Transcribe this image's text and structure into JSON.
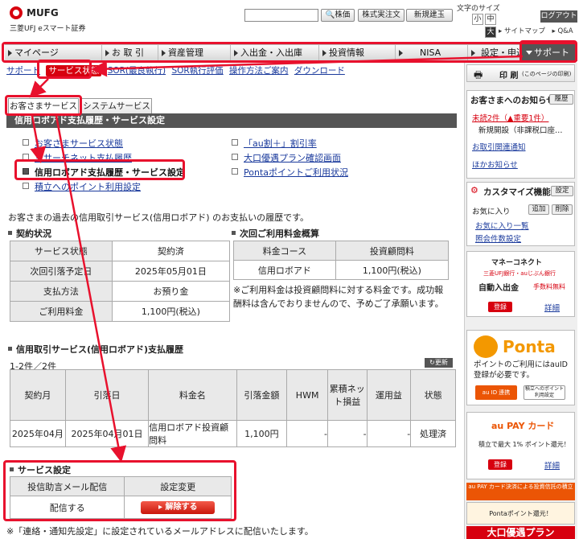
{
  "header": {
    "logo_mufg": "MUFG",
    "logo_sub": "三菱UFJ eスマート証券",
    "search_placeholder": "",
    "search_btn": "株価",
    "btn_margin": "株式実注文",
    "btn_shinki": "新規建玉",
    "fontsize_label": "文字のサイズ",
    "fs_small": "小",
    "fs_mid": "中",
    "fs_large": "大",
    "logout": "ログアウト",
    "sitemap": "▸ サイトマップ　▸ Q&A"
  },
  "nav": [
    "マイページ",
    "お 取 引",
    "資産管理",
    "入出金・入出庫",
    "投資情報",
    "NISA",
    "設定・申込"
  ],
  "nav_support": "サポート",
  "subnav": {
    "items": [
      "サポート",
      "サービス状態",
      "SOR(最良執行)",
      "SOR執行評価",
      "操作方法ご案内",
      "ダウンロード"
    ],
    "current": "サービス状態"
  },
  "tabs": {
    "customer": "お客さまサービス",
    "system": "システムサービス"
  },
  "title": "信用ロボアド支払履歴・サービス設定",
  "links_left": [
    "お客さまサービス状態",
    "リサーチネット支払履歴",
    "信用ロボアド支払履歴・サービス設定",
    "積立へのポイント利用設定"
  ],
  "links_right": [
    "「au割＋」割引率",
    "大口優遇プラン確認画面",
    "Pontaポイントご利用状況"
  ],
  "intro": "お客さまの過去の信用取引サービス(信用ロボアド) のお支払いの履歴です。",
  "contract": {
    "title": "契約状況",
    "rows": [
      {
        "label": "サービス状態",
        "value": "契約済"
      },
      {
        "label": "次回引落予定日",
        "value": "2025年05月01日"
      },
      {
        "label": "支払方法",
        "value": "お預り金"
      },
      {
        "label": "ご利用料金",
        "value": "1,100円(税込)"
      }
    ]
  },
  "next_fee": {
    "title": "次回ご利用料金概算",
    "headers": [
      "料金コース",
      "投資顧問料"
    ],
    "row": [
      "信用ロボアド",
      "1,100円(税込)"
    ],
    "note": "※ご利用料金は投資顧問料に対する料金です。成功報酬料は含んでおりませんので、予めご了承願います。"
  },
  "history": {
    "title": "信用取引サービス(信用ロボアド)支払履歴",
    "count": "1-2件／2件",
    "refresh": "更新",
    "headers": [
      "契約月",
      "引落日",
      "料金名",
      "引落金額",
      "HWM",
      "累積ネット損益",
      "運用益",
      "状態"
    ],
    "rows": [
      [
        "2025年04月",
        "2025年04月01日",
        "信用ロボアド投資顧問料",
        "1,100円",
        "-",
        "-",
        "-",
        "処理済"
      ]
    ]
  },
  "service_settings": {
    "title": "サービス設定",
    "headers": [
      "投信助言メール配信",
      "設定変更"
    ],
    "status": "配信する",
    "button": "解除する"
  },
  "footnote": "※「連絡・通知先設定」に設定されているメールアドレスに配信いたします。",
  "sidebar": {
    "print": "印 刷",
    "print_sub": "(このページの印刷)",
    "notice_title": "お客さまへのお知らせ",
    "notice_btn": "履歴",
    "notice_items": [
      "未読2件（▲重要1件）",
      "新規開設（非課税口座…",
      "お取引関連通知",
      "ほかお知らせ"
    ],
    "custom_title": "カスタマイズ機能",
    "custom_btn": "設定",
    "fav_label": "お気に入り",
    "fav_add": "追加",
    "fav_del": "削除",
    "fav_items": [
      "お気に入り一覧",
      "照会件数設定"
    ],
    "money_title": "マネーコネクト",
    "money_sub": "三菱UFJ銀行・auじぶん銀行",
    "money_feature": "自動入出金",
    "money_fee": "手数料無料",
    "btn_register": "登録",
    "btn_detail": "詳細",
    "ponta": "Ponta",
    "ponta_text": "ポイントのご利用にはauID登録が必要です。",
    "ponta_auid": "au ID 連携",
    "ponta_open": "積立へのポイント利用設定",
    "aupay": "au PAY カード",
    "aupay_text": "積立で最大 1% ポイント還元！",
    "banner1": "au PAY カード決済による投資信託の積立",
    "banner2": "Pontaポイント還元！",
    "banner3": "大口優遇プラン"
  },
  "colors": {
    "accent_red": "#d7000f",
    "annotation_red": "#e8112d",
    "title_bar": "#555555"
  }
}
